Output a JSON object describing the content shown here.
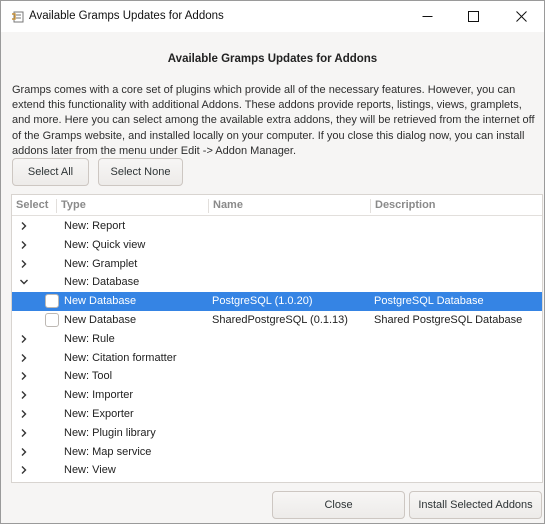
{
  "window": {
    "title": "Available Gramps Updates for Addons"
  },
  "heading": "Available Gramps Updates for Addons",
  "intro": "Gramps comes with a core set of plugins which provide all of the necessary features. However, you can extend this functionality with additional Addons. These addons provide reports, listings, views, gramplets, and more. Here you can select among the available extra addons, they will be retrieved from the internet off of the Gramps website, and installed locally on your computer. If you close this dialog now, you can install addons later from the menu under Edit -> Addon Manager.",
  "buttons": {
    "select_all": "Select All",
    "select_none": "Select None",
    "close": "Close",
    "install": "Install Selected Addons"
  },
  "columns": [
    "Select",
    "Type",
    "Name",
    "Description"
  ],
  "rows": [
    {
      "type": "New: Report",
      "expander": "chevron-right",
      "checkbox": false,
      "name": "",
      "description": ""
    },
    {
      "type": "New: Quick view",
      "expander": "chevron-right",
      "checkbox": false,
      "name": "",
      "description": ""
    },
    {
      "type": "New: Gramplet",
      "expander": "chevron-right",
      "checkbox": false,
      "name": "",
      "description": ""
    },
    {
      "type": "New: Database",
      "expander": "chevron-down",
      "checkbox": false,
      "name": "",
      "description": ""
    },
    {
      "type": "New Database",
      "expander": "",
      "checkbox": true,
      "checked": false,
      "selected": true,
      "name": "PostgreSQL (1.0.20)",
      "description": "PostgreSQL Database"
    },
    {
      "type": "New Database",
      "expander": "",
      "checkbox": true,
      "checked": false,
      "name": "SharedPostgreSQL (0.1.13)",
      "description": "Shared PostgreSQL Database"
    },
    {
      "type": "New: Rule",
      "expander": "chevron-right",
      "checkbox": false,
      "name": "",
      "description": ""
    },
    {
      "type": "New: Citation formatter",
      "expander": "chevron-right",
      "checkbox": false,
      "name": "",
      "description": ""
    },
    {
      "type": "New: Tool",
      "expander": "chevron-right",
      "checkbox": false,
      "name": "",
      "description": ""
    },
    {
      "type": "New: Importer",
      "expander": "chevron-right",
      "checkbox": false,
      "name": "",
      "description": ""
    },
    {
      "type": "New: Exporter",
      "expander": "chevron-right",
      "checkbox": false,
      "name": "",
      "description": ""
    },
    {
      "type": "New: Plugin library",
      "expander": "chevron-right",
      "checkbox": false,
      "name": "",
      "description": ""
    },
    {
      "type": "New: Map service",
      "expander": "chevron-right",
      "checkbox": false,
      "name": "",
      "description": ""
    },
    {
      "type": "New: View",
      "expander": "chevron-right",
      "checkbox": false,
      "name": "",
      "description": ""
    }
  ],
  "colors": {
    "selection": "#3584e4",
    "window_bg": "#f6f5f4"
  }
}
